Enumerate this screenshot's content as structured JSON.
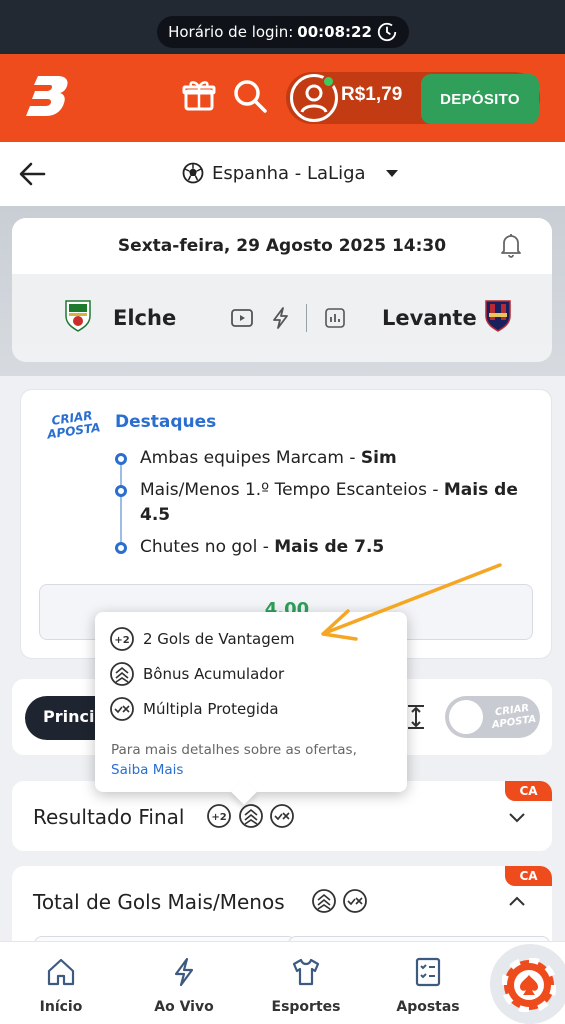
{
  "status": {
    "login_label": "Horário de login:",
    "login_time": "00:08:22"
  },
  "header": {
    "balance": "R$1,79",
    "deposit_label": "DEPÓSITO"
  },
  "league": {
    "name": "Espanha - LaLiga"
  },
  "match": {
    "date": "Sexta-feira, 29 Agosto 2025 14:30",
    "home": "Elche",
    "away": "Levante"
  },
  "highlights": {
    "badge": "CRIAR APOSTA",
    "title": "Destaques",
    "items": [
      {
        "label": "Ambas equipes Marcam - ",
        "value": "Sim"
      },
      {
        "label": "Mais/Menos 1.º Tempo Escanteios - ",
        "value": "Mais de 4.5"
      },
      {
        "label": "Chutes no gol - ",
        "value": "Mais de 7.5"
      }
    ],
    "odds": "4.00"
  },
  "tabs": {
    "principal": "Principal",
    "toggle_label": "CRIAR APOSTA"
  },
  "markets": [
    {
      "title": "Resultado Final",
      "badge": "CA"
    },
    {
      "title": "Total de Gols Mais/Menos",
      "badge": "CA"
    }
  ],
  "tooltip": {
    "offers": [
      "2 Gols de Vantagem",
      "Bônus Acumulador",
      "Múltipla Protegida"
    ],
    "note": "Para mais detalhes sobre as ofertas,",
    "link": "Saiba Mais"
  },
  "nav": [
    "Início",
    "Ao Vivo",
    "Esportes",
    "Apostas"
  ],
  "colors": {
    "brand": "#ee4c1c",
    "deposit": "#2f9f5a",
    "accent_blue": "#2a6fd0",
    "annotation": "#f5a623"
  }
}
